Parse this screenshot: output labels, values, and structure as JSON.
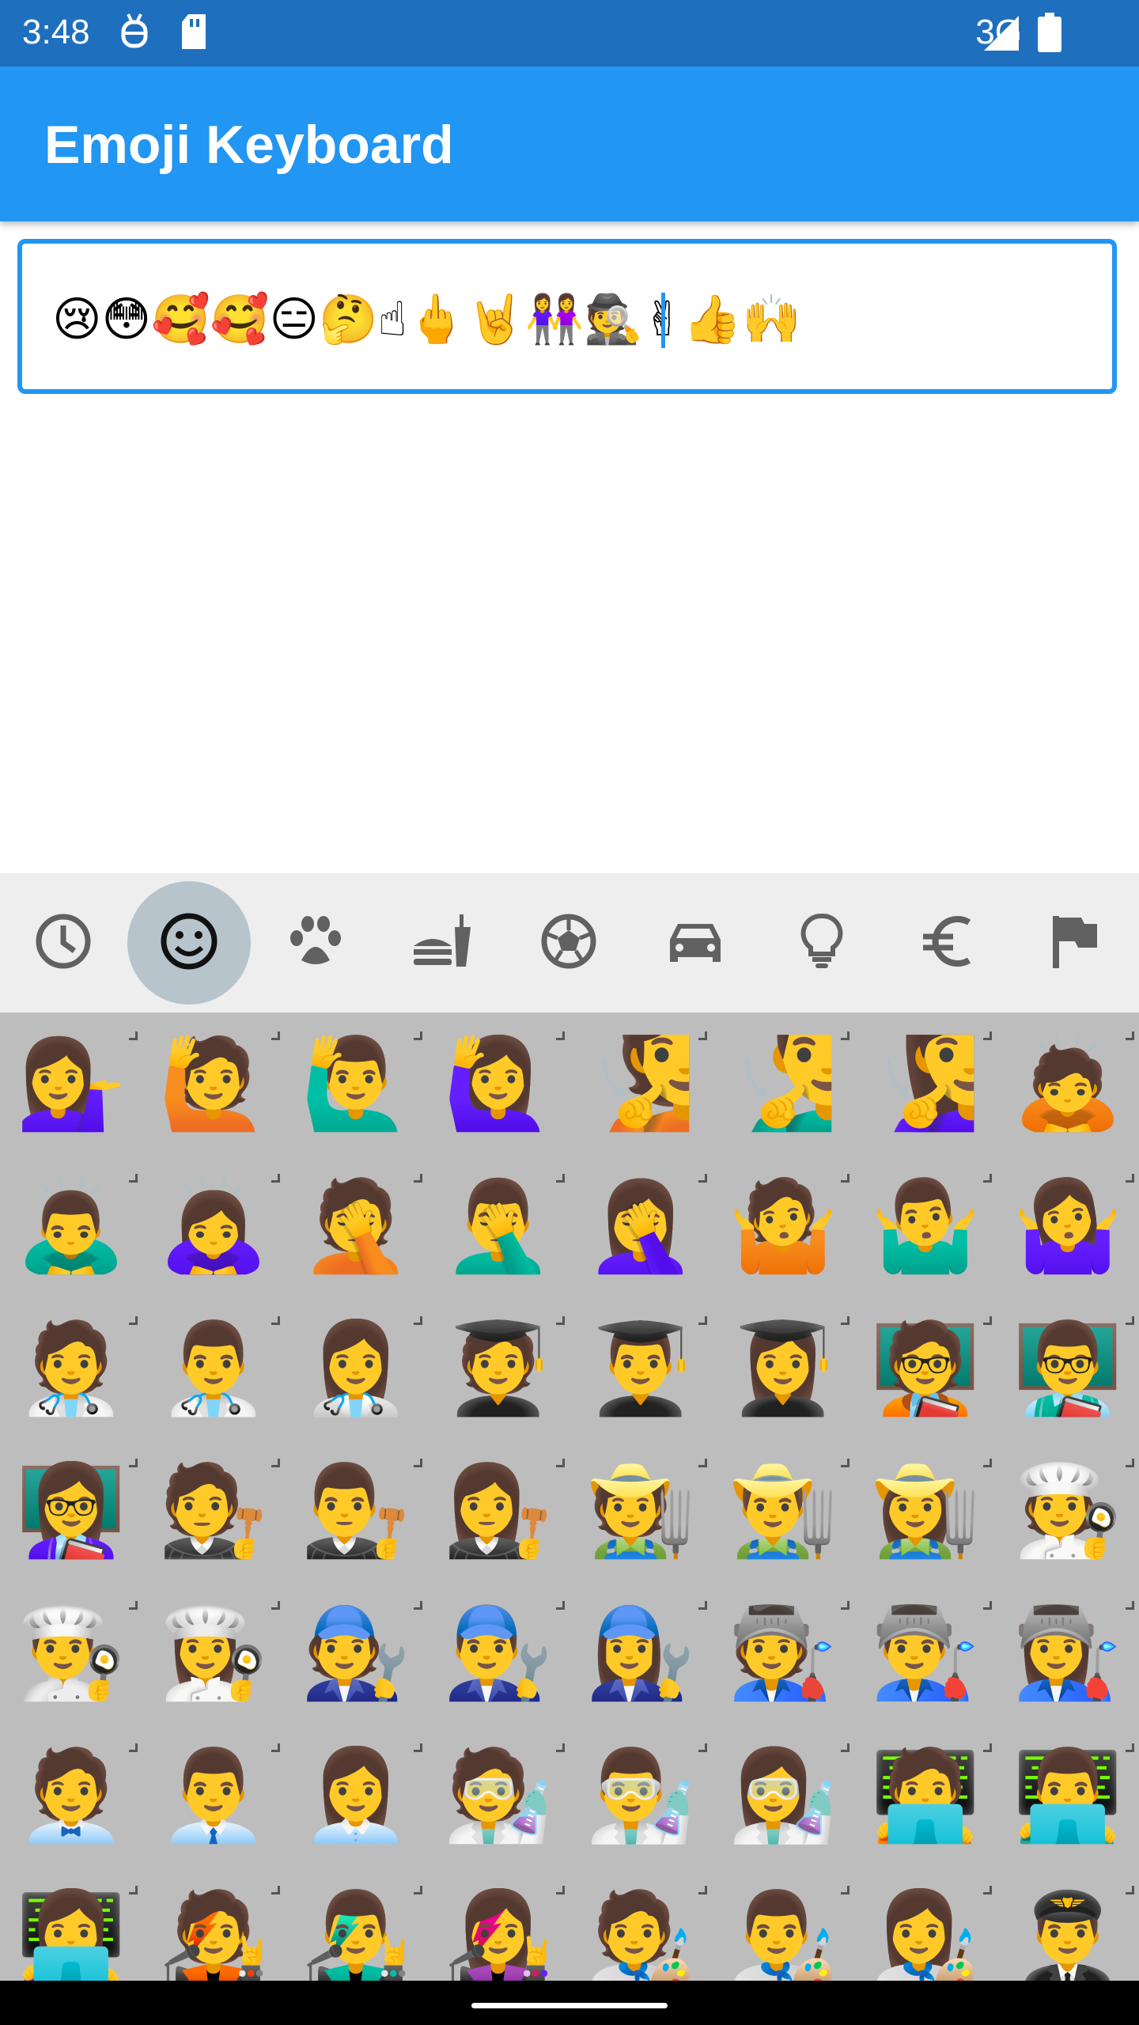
{
  "status_bar": {
    "time": "3:48",
    "network": "3G",
    "icons": [
      "android-debug-icon",
      "sd-card-icon",
      "signal-icon",
      "battery-icon"
    ]
  },
  "app_bar": {
    "title": "Emoji Keyboard"
  },
  "input": {
    "value": "😢😳🥰🥰😑🤔☝🖕🤘👭🕵✌👍🙌"
  },
  "category_bar": {
    "selected_index": 1,
    "tabs": [
      "recent-icon",
      "smiley-icon",
      "paw-icon",
      "food-icon",
      "soccer-ball-icon",
      "car-icon",
      "lightbulb-icon",
      "euro-icon",
      "flag-icon"
    ]
  },
  "emoji_grid": {
    "rows": [
      [
        "💁‍♀️",
        "🙋",
        "🙋‍♂️",
        "🙋‍♀️",
        "🧏",
        "🧏‍♂️",
        "🧏‍♀️",
        "🙇"
      ],
      [
        "🙇‍♂️",
        "🙇‍♀️",
        "🤦",
        "🤦‍♂️",
        "🤦‍♀️",
        "🤷",
        "🤷‍♂️",
        "🤷‍♀️"
      ],
      [
        "🧑‍⚕️",
        "👨‍⚕️",
        "👩‍⚕️",
        "🧑‍🎓",
        "👨‍🎓",
        "👩‍🎓",
        "🧑‍🏫",
        "👨‍🏫"
      ],
      [
        "👩‍🏫",
        "🧑‍⚖️",
        "👨‍⚖️",
        "👩‍⚖️",
        "🧑‍🌾",
        "👨‍🌾",
        "👩‍🌾",
        "🧑‍🍳"
      ],
      [
        "👨‍🍳",
        "👩‍🍳",
        "🧑‍🔧",
        "👨‍🔧",
        "👩‍🔧",
        "🧑‍🏭",
        "👨‍🏭",
        "👩‍🏭"
      ],
      [
        "🧑‍💼",
        "👨‍💼",
        "👩‍💼",
        "🧑‍🔬",
        "👨‍🔬",
        "👩‍🔬",
        "🧑‍💻",
        "👨‍💻"
      ],
      [
        "👩‍💻",
        "🧑‍🎤",
        "👨‍🎤",
        "👩‍🎤",
        "🧑‍🎨",
        "👨‍🎨",
        "👩‍🎨",
        "👨‍✈️"
      ]
    ]
  },
  "colors": {
    "status_bar": "#1e6fbd",
    "app_bar": "#2196f3",
    "accent": "#2196f3",
    "category_bar": "#eeeeee",
    "grid_background": "#bdbdbd"
  }
}
